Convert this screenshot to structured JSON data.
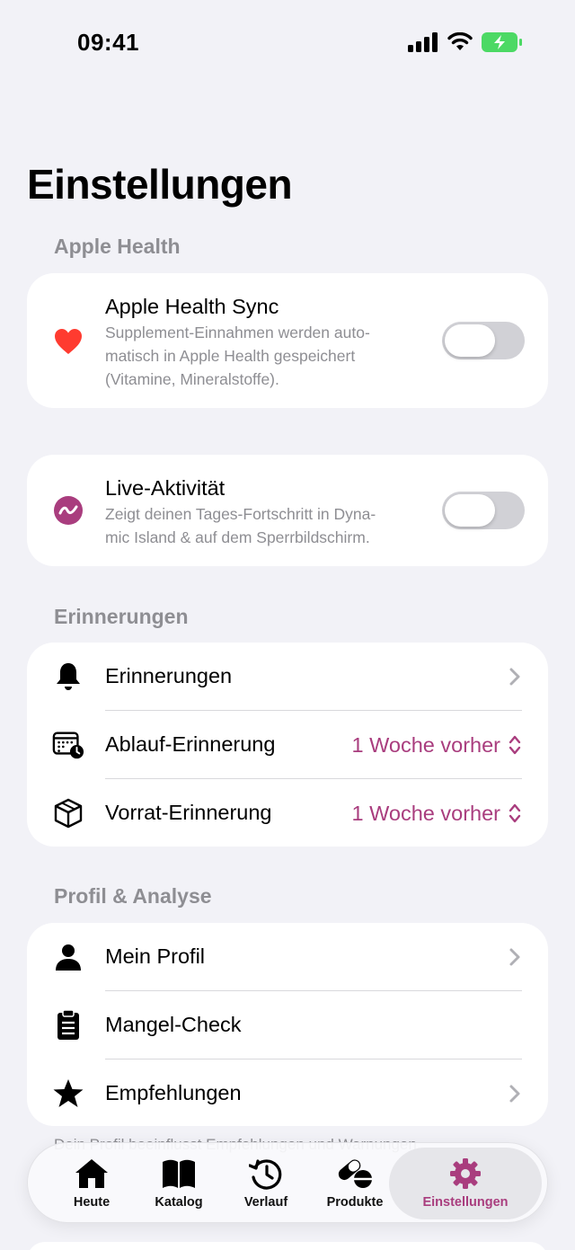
{
  "status_bar": {
    "time": "09:41"
  },
  "page": {
    "title": "Einstellungen"
  },
  "sections": {
    "health": {
      "header": "Apple Health",
      "sync": {
        "title": "Apple Health Sync",
        "subtitle_lines": [
          "Supplement-Einnahmen werden auto-",
          "matisch in Apple Health gespeichert",
          "(Vitamine, Mineralstoffe)."
        ],
        "enabled": false
      },
      "live": {
        "title": "Live-Aktivität",
        "subtitle_lines": [
          "Zeigt deinen Tages-Fortschritt in Dyna-",
          "mic Island & auf dem Sperrbildschirm."
        ],
        "enabled": false
      }
    },
    "reminders": {
      "header": "Erinnerungen",
      "items": [
        {
          "label": "Erinnerungen",
          "icon": "bell-icon"
        },
        {
          "label": "Ablauf-Erinnerung",
          "value": "1 Woche vorher",
          "icon": "calendar-clock-icon"
        },
        {
          "label": "Vorrat-Erinnerung",
          "value": "1 Woche vorher",
          "icon": "box-icon"
        }
      ]
    },
    "profile": {
      "header": "Profil & Analyse",
      "items": [
        {
          "label": "Mein Profil",
          "icon": "person-icon"
        },
        {
          "label": "Mangel-Check",
          "icon": "clipboard-icon"
        },
        {
          "label": "Empfehlungen",
          "icon": "star-icon"
        }
      ],
      "footer_note": "Dein Profil beeinflusst Empfehlungen und Warnungen."
    }
  },
  "tab_bar": {
    "tabs": [
      {
        "label": "Heute",
        "icon": "house-icon"
      },
      {
        "label": "Katalog",
        "icon": "book-icon"
      },
      {
        "label": "Verlauf",
        "icon": "history-icon"
      },
      {
        "label": "Produkte",
        "icon": "pills-icon"
      },
      {
        "label": "Einstellungen",
        "icon": "gear-icon",
        "active": true
      }
    ]
  },
  "colors": {
    "accent": "#a93d7e",
    "heart": "#ff3b30",
    "background": "#f2f2f7",
    "secondary_text": "#8e8e93"
  }
}
